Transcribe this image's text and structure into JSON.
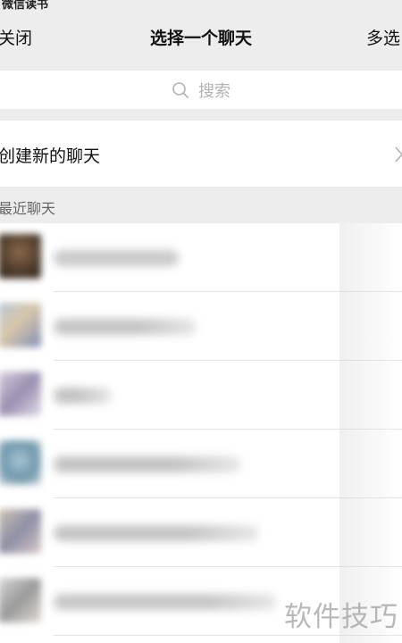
{
  "status_bar": {
    "app_name": "微信读书"
  },
  "nav": {
    "close": "关闭",
    "title": "选择一个聊天",
    "multi_select": "多选"
  },
  "search": {
    "placeholder": "搜索",
    "icon": "search-icon"
  },
  "new_chat": {
    "label": "创建新的聊天",
    "icon": "chevron-right-icon"
  },
  "recent": {
    "section_label": "最近聊天"
  },
  "watermark": "软件技巧",
  "colors": {
    "background": "#ededed",
    "card": "#ffffff",
    "muted_text": "#b2b2b2"
  }
}
